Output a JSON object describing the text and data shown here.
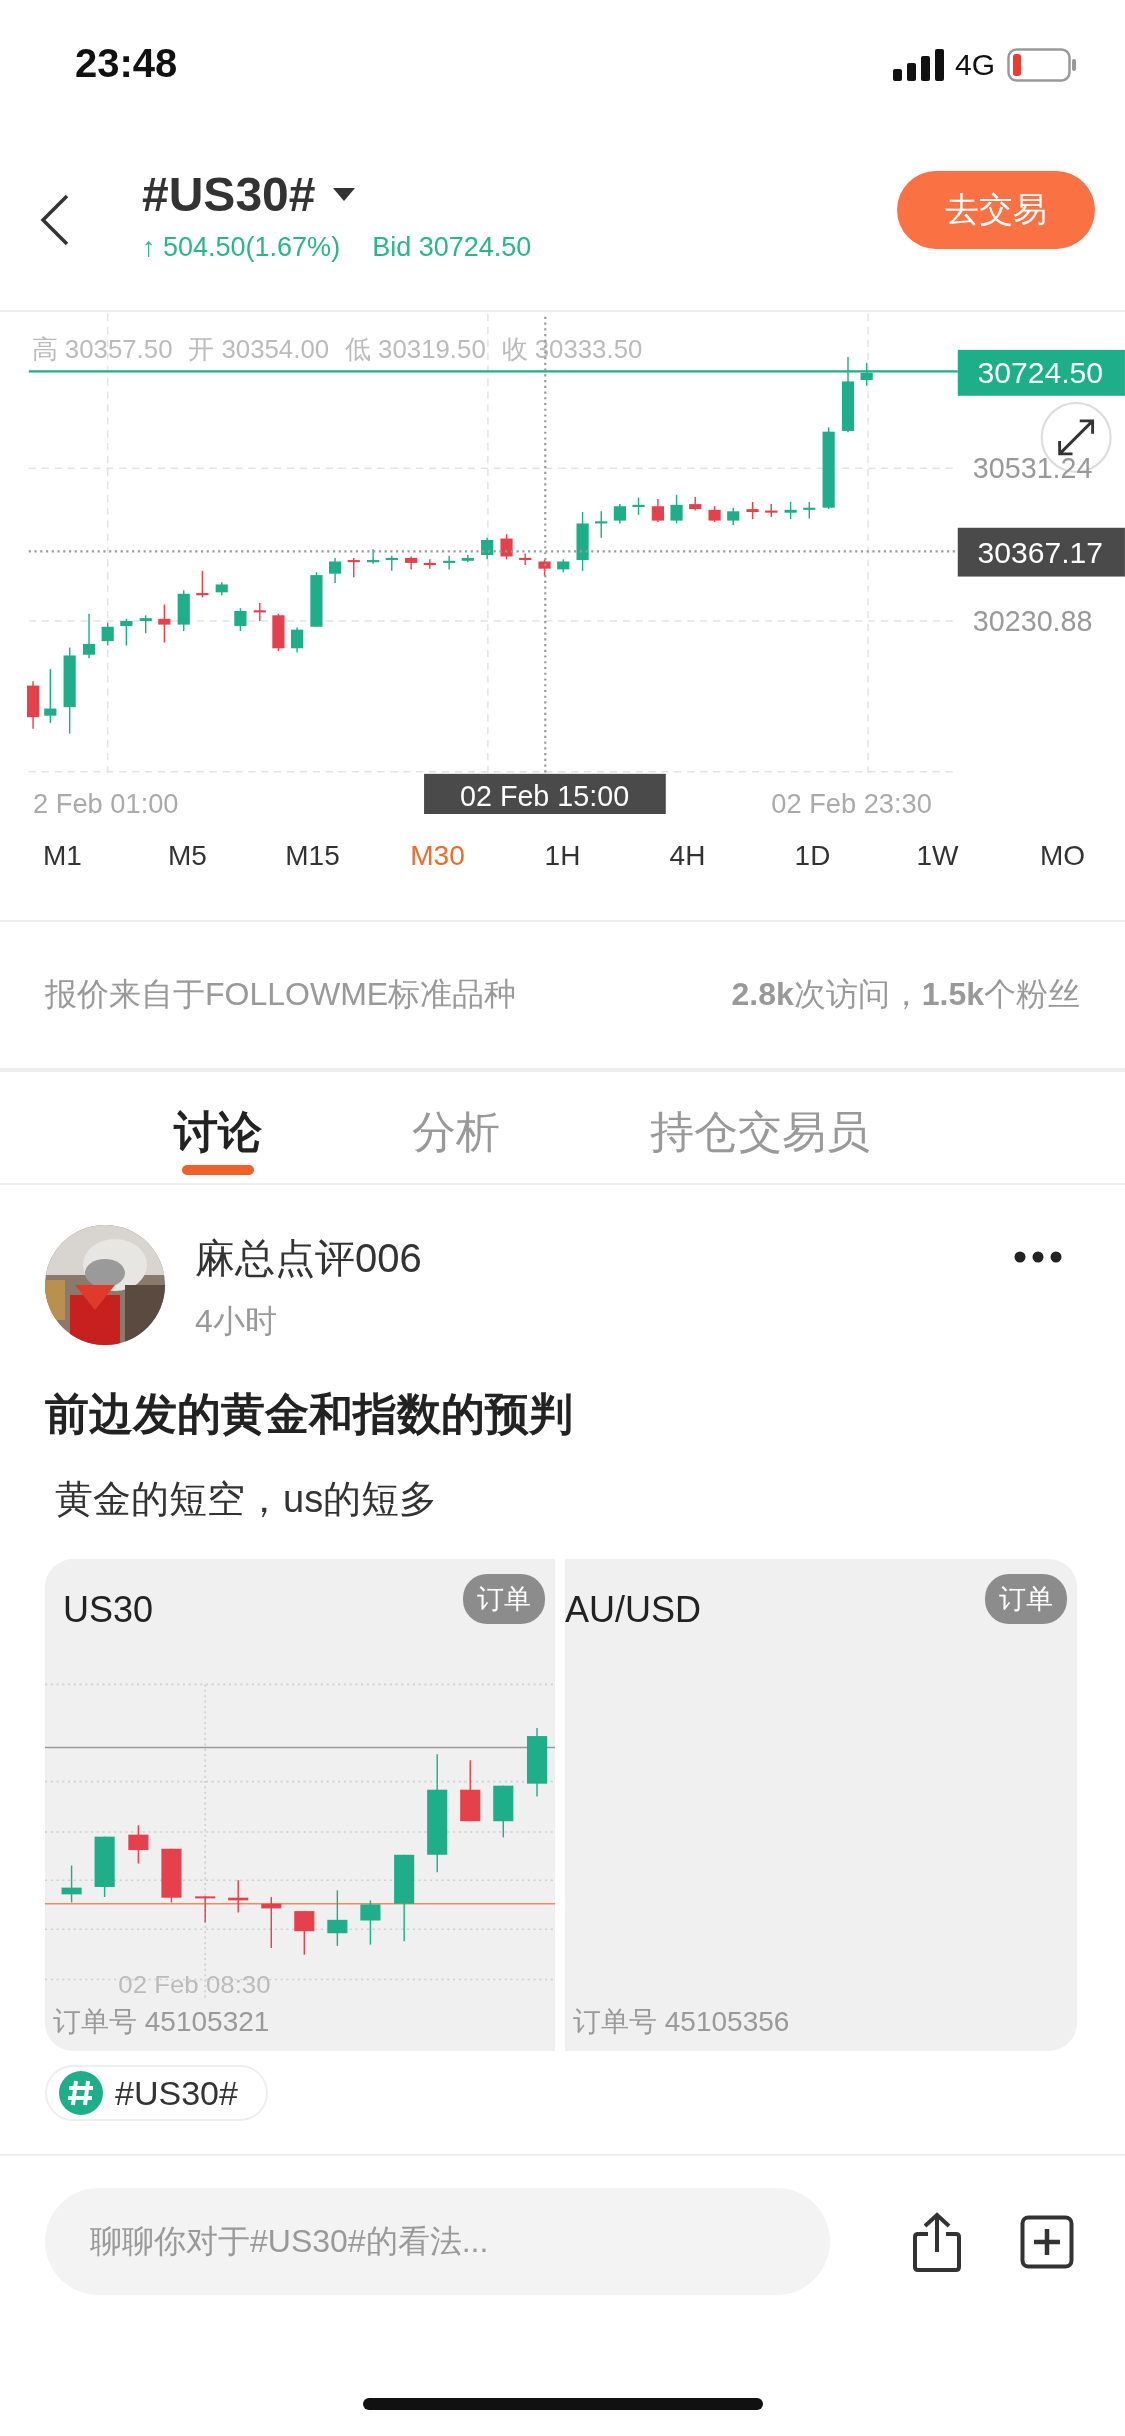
{
  "status_bar": {
    "time": "23:48",
    "network": "4G"
  },
  "header": {
    "title": "#US30#",
    "change": "↑ 504.50(1.67%)",
    "bid": "Bid 30724.50",
    "trade_button": "去交易"
  },
  "chart": {
    "ohlc": [
      "高 30357.50",
      "开 30354.00",
      "低 30319.50",
      "收 30333.50"
    ],
    "current_price": "30724.50",
    "crosshair_price": "30367.17",
    "price_labels": [
      "30531.24",
      "30230.88"
    ],
    "time_labels": [
      "2 Feb 01:00",
      "02 Feb 23:30"
    ],
    "crosshair_time": "02 Feb 15:00"
  },
  "timeframes": [
    {
      "label": "M1",
      "selected": false
    },
    {
      "label": "M5",
      "selected": false
    },
    {
      "label": "M15",
      "selected": false
    },
    {
      "label": "M30",
      "selected": true
    },
    {
      "label": "1H",
      "selected": false
    },
    {
      "label": "4H",
      "selected": false
    },
    {
      "label": "1D",
      "selected": false
    },
    {
      "label": "1W",
      "selected": false
    },
    {
      "label": "MO",
      "selected": false
    }
  ],
  "info": {
    "source": "报价来自于FOLLOWME标准品种",
    "stats": "**2.8k**次访问，**1.5k**个粉丝"
  },
  "tabs": [
    {
      "label": "讨论",
      "selected": true
    },
    {
      "label": "分析",
      "selected": false
    },
    {
      "label": "持仓交易员",
      "selected": false
    }
  ],
  "post": {
    "author": "麻总点评006",
    "time": "4小时",
    "title": "前边发的黄金和指数的预判",
    "body": "黄金的短空，us的短多",
    "cards": [
      {
        "kind": "chart",
        "symbol": "US30",
        "badge": "订单",
        "date_label": "02 Feb 08:30",
        "order": "订单号 45105321"
      },
      {
        "kind": "blank",
        "symbol": "AU/USD",
        "badge": "订单",
        "order": "订单号 45105356"
      }
    ],
    "tag": "#US30#"
  },
  "comment": {
    "placeholder": "聊聊你对于#US30#的看法..."
  }
}
